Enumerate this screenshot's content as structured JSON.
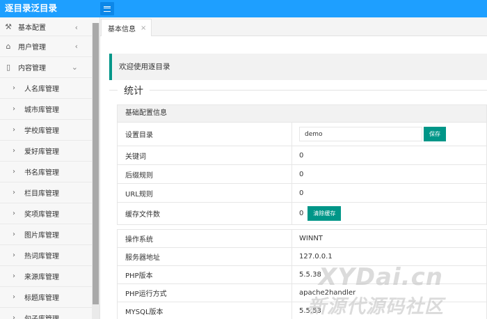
{
  "app": {
    "title": "逐目录泛目录"
  },
  "sidebar": {
    "items": [
      {
        "label": "基本配置",
        "icon": "tools-icon",
        "arrow": "‹"
      },
      {
        "label": "用户管理",
        "icon": "home-icon",
        "arrow": "‹"
      },
      {
        "label": "内容管理",
        "icon": "document-icon",
        "arrow": "⌄"
      }
    ],
    "sub_items": [
      {
        "label": "人名库管理"
      },
      {
        "label": "城市库管理"
      },
      {
        "label": "学校库管理"
      },
      {
        "label": "爱好库管理"
      },
      {
        "label": "书名库管理"
      },
      {
        "label": "栏目库管理"
      },
      {
        "label": "奖项库管理"
      },
      {
        "label": "图片库管理"
      },
      {
        "label": "热词库管理"
      },
      {
        "label": "来源库管理"
      },
      {
        "label": "标题库管理"
      },
      {
        "label": "句子库管理"
      }
    ]
  },
  "tabs": [
    {
      "label": "基本信息",
      "close": "×"
    }
  ],
  "main": {
    "welcome": "欢迎使用逐目录",
    "legend": "统计",
    "section_title": "基础配置信息",
    "config_rows": [
      {
        "key": "设置目录",
        "value": "demo",
        "button": "保存"
      },
      {
        "key": "关键词",
        "value": "0"
      },
      {
        "key": "后缀规则",
        "value": "0"
      },
      {
        "key": "URL规则",
        "value": "0"
      },
      {
        "key": "缓存文件数",
        "value": "0",
        "button": "清除缓存"
      }
    ],
    "system_rows": [
      {
        "key": "操作系统",
        "value": "WINNT"
      },
      {
        "key": "服务器地址",
        "value": "127.0.0.1"
      },
      {
        "key": "PHP版本",
        "value": "5.5.38"
      },
      {
        "key": "PHP运行方式",
        "value": "apache2handler"
      },
      {
        "key": "MYSQL版本",
        "value": "5.5.53"
      }
    ]
  },
  "watermark": {
    "top": "XYDai.cn",
    "bottom": "新源代源码社区"
  },
  "colors": {
    "topbar": "#1e9fff",
    "accent": "#009688"
  }
}
